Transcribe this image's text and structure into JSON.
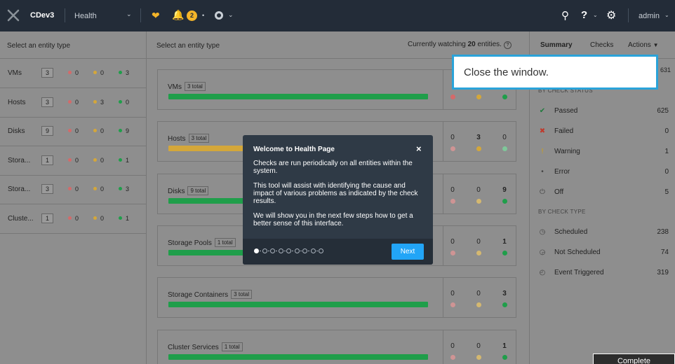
{
  "colors": {
    "red": "#d46a6a",
    "yellow": "#d4a73a",
    "green": "#1f9e4a",
    "accent": "#22a5f7",
    "light_green": "#7fc79a",
    "light_red": "#cf9494"
  },
  "topbar": {
    "logo_icon": "x-logo-icon",
    "cluster_name": "CDev3",
    "page_name": "Health",
    "alert_count": "2",
    "user": "admin"
  },
  "left": {
    "header": "Select an entity type",
    "rows": [
      {
        "name": "VMs",
        "count": "3",
        "red": "0",
        "yellow": "0",
        "green": "3"
      },
      {
        "name": "Hosts",
        "count": "3",
        "red": "0",
        "yellow": "3",
        "green": "0"
      },
      {
        "name": "Disks",
        "count": "9",
        "red": "0",
        "yellow": "0",
        "green": "9"
      },
      {
        "name": "Stora...",
        "count": "1",
        "red": "0",
        "yellow": "0",
        "green": "1"
      },
      {
        "name": "Stora...",
        "count": "3",
        "red": "0",
        "yellow": "0",
        "green": "3"
      },
      {
        "name": "Cluste...",
        "count": "1",
        "red": "0",
        "yellow": "0",
        "green": "1"
      }
    ]
  },
  "middle": {
    "header": "Select an entity type",
    "watching_prefix": "Currently watching",
    "watching_count": "20",
    "watching_suffix": "entities.",
    "help_glyph": "?",
    "cards": [
      {
        "title": "VMs",
        "tag": "3 total",
        "bar": "green",
        "red": "",
        "yellow": "",
        "green": "",
        "bold": ""
      },
      {
        "title": "Hosts",
        "tag": "3 total",
        "bar": "yellow",
        "red": "0",
        "yellow": "3",
        "green": "0",
        "bold": "yellow"
      },
      {
        "title": "Disks",
        "tag": "9 total",
        "bar": "green",
        "red": "0",
        "yellow": "0",
        "green": "9",
        "bold": "green"
      },
      {
        "title": "Storage Pools",
        "tag": "1 total",
        "bar": "green",
        "red": "0",
        "yellow": "0",
        "green": "1",
        "bold": "green"
      },
      {
        "title": "Storage Containers",
        "tag": "3 total",
        "bar": "green",
        "red": "0",
        "yellow": "0",
        "green": "3",
        "bold": "green"
      },
      {
        "title": "Cluster Services",
        "tag": "1 total",
        "bar": "green",
        "red": "0",
        "yellow": "0",
        "green": "1",
        "bold": "green"
      }
    ]
  },
  "right": {
    "tabs": {
      "summary": "Summary",
      "checks": "Checks",
      "actions": "Actions"
    },
    "total": "631",
    "status_section": "BY CHECK STATUS",
    "statuses": [
      {
        "label": "Passed",
        "count": "625",
        "icon": "check-icon"
      },
      {
        "label": "Failed",
        "count": "0",
        "icon": "x-icon"
      },
      {
        "label": "Warning",
        "count": "1",
        "icon": "exclamation-icon"
      },
      {
        "label": "Error",
        "count": "0",
        "icon": "error-icon"
      },
      {
        "label": "Off",
        "count": "5",
        "icon": "power-icon"
      }
    ],
    "type_section": "BY CHECK TYPE",
    "types": [
      {
        "label": "Scheduled",
        "count": "238",
        "icon": "clock-icon"
      },
      {
        "label": "Not Scheduled",
        "count": "74",
        "icon": "clock-off-icon"
      },
      {
        "label": "Event Triggered",
        "count": "319",
        "icon": "event-icon"
      }
    ]
  },
  "modal": {
    "title": "Welcome to Health Page",
    "close_glyph": "×",
    "paragraphs": [
      "Checks are run periodically on all entities within the system.",
      "This tool will assist with identifying the cause and impact of various problems as indicated by the check results.",
      "We will show you in the next few steps how to get a better sense of this interface."
    ],
    "step_total": 9,
    "step_current": 1,
    "next_label": "Next"
  },
  "tooltip": {
    "text": "Close the window."
  },
  "complete_label": "Complete"
}
